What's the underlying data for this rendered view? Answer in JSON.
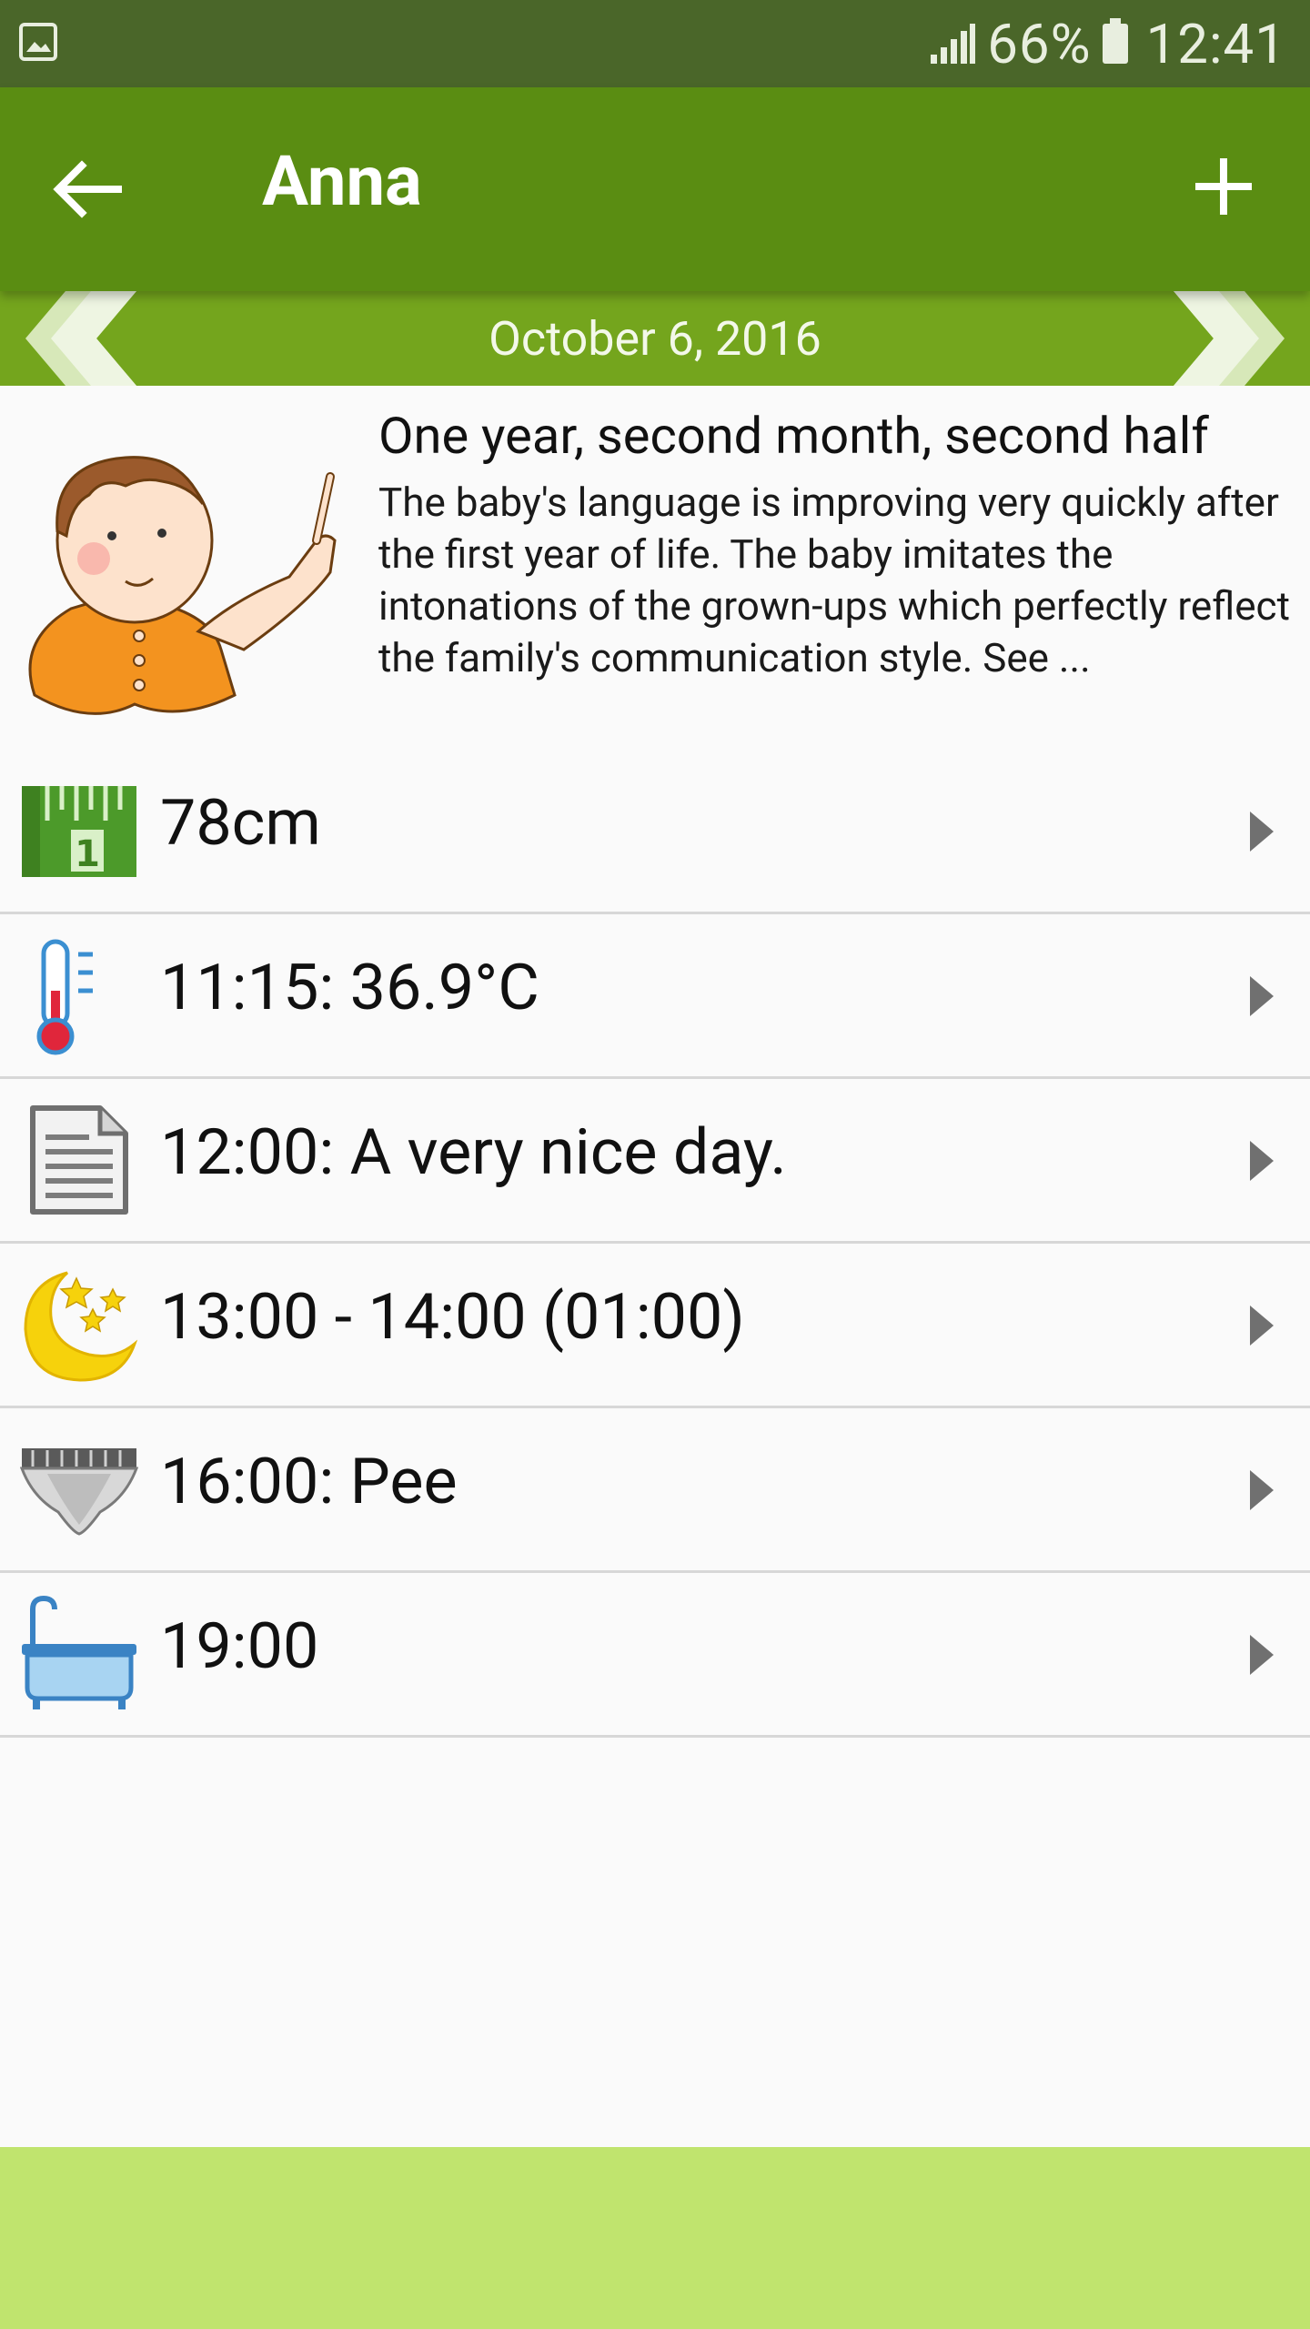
{
  "status": {
    "battery": "66%",
    "time": "12:41"
  },
  "appbar": {
    "title": "Anna"
  },
  "date": {
    "label": "October 6, 2016"
  },
  "info": {
    "title": "One year, second month, second half",
    "text": "The baby's language is improving very quickly after the first year of life. The baby imitates the intonations of the grown-ups which perfectly reflect the family's communication style. See ..."
  },
  "entries": [
    {
      "icon": "ruler-icon",
      "text": "78cm"
    },
    {
      "icon": "thermometer-icon",
      "text": "11:15: 36.9°C"
    },
    {
      "icon": "note-icon",
      "text": "12:00: A very nice day."
    },
    {
      "icon": "moon-stars-icon",
      "text": "13:00 - 14:00 (01:00)"
    },
    {
      "icon": "diaper-icon",
      "text": "16:00: Pee"
    },
    {
      "icon": "bathtub-icon",
      "text": "19:00"
    }
  ],
  "colors": {
    "statusbar": "#4a6629",
    "appbar": "#5a8d12",
    "datebar": "#74a51d",
    "bottom": "#c0e46e"
  }
}
